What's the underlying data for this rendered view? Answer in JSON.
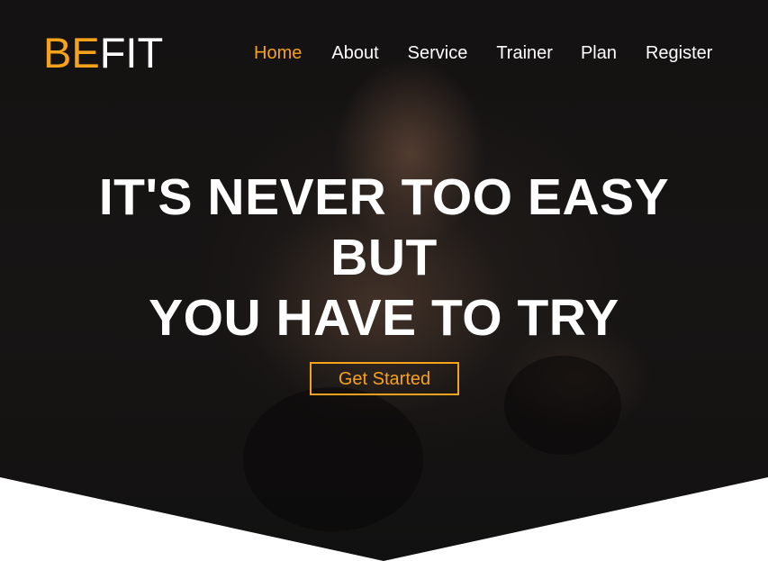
{
  "brand": {
    "prefix": "BE",
    "suffix": "FIT",
    "accent_color": "#f7a21b"
  },
  "nav": {
    "items": [
      {
        "label": "Home",
        "active": true
      },
      {
        "label": "About",
        "active": false
      },
      {
        "label": "Service",
        "active": false
      },
      {
        "label": "Trainer",
        "active": false
      },
      {
        "label": "Plan",
        "active": false
      },
      {
        "label": "Register",
        "active": false
      }
    ]
  },
  "hero": {
    "headline": {
      "line1": "IT'S NEVER TOO EASY",
      "line2": "BUT",
      "line3": "YOU HAVE TO TRY"
    },
    "cta_label": "Get Started",
    "background": "dark gym photo of man lifting kettlebell"
  }
}
